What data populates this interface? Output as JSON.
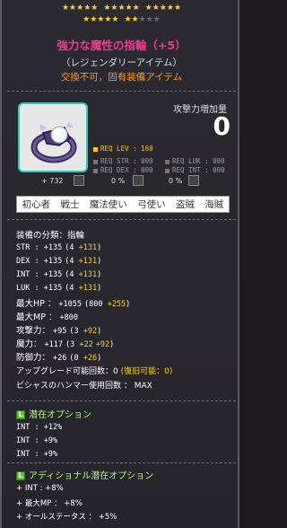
{
  "stars": {
    "row1_filled": 15,
    "row2_filled": 7,
    "row2_empty": 3
  },
  "item": {
    "name": "強力な魔性の指輪（+5）",
    "rarity": "（レジェンダリーアイテム）",
    "trade": "交換不可，固有装備アイテム"
  },
  "attack": {
    "label": "攻撃力増加量",
    "value": "0"
  },
  "requirements": {
    "lev": "REQ LEV : 160",
    "str": "REQ STR : 000",
    "dex": "REQ DEX : 000",
    "luk": "REQ LUK : 000",
    "int": "REQ INT : 000"
  },
  "mini_stats": [
    "+ 732",
    "0 %",
    "0 %"
  ],
  "jobs": [
    "初心者",
    "戦士",
    "魔法使い",
    "弓使い",
    "盗賊",
    "海賊"
  ],
  "stats": {
    "category": "装備の分類：指輪",
    "str": {
      "label": "STR : ",
      "total": "+135",
      "detail_open": "(4 ",
      "bonus": "+131",
      "detail_close": ")"
    },
    "dex": {
      "label": "DEX : ",
      "total": "+135",
      "detail_open": "(4 ",
      "bonus": "+131",
      "detail_close": ")"
    },
    "int": {
      "label": "INT : ",
      "total": "+135",
      "detail_open": "(4 ",
      "bonus": "+131",
      "detail_close": ")"
    },
    "luk": {
      "label": "LUK : ",
      "total": "+135",
      "detail_open": "(4 ",
      "bonus": "+131",
      "detail_close": ")"
    },
    "hp": {
      "label": "最大HP ： ",
      "total": "+1055",
      "detail_open": "(800 ",
      "bonus": "+255",
      "detail_close": ")"
    },
    "mp": {
      "label": "最大MP ： ",
      "total": "+800"
    },
    "atk": {
      "label": "攻撃力： ",
      "total": "+95",
      "detail_open": "(3 ",
      "bonus": "+92",
      "detail_close": ")"
    },
    "matk": {
      "label": "魔力： ",
      "total": "+117",
      "detail_open": "(3 ",
      "bonus_a": "+22",
      "bonus": "+92",
      "detail_close": ")"
    },
    "def": {
      "label": "防御力： ",
      "total": "+26",
      "detail_open": "(0 ",
      "bonus": "+26",
      "detail_close": ")"
    },
    "upgrade": {
      "text": "アップグレード可能回数：0 ",
      "recover": "(復旧可能：0)"
    },
    "hammer": "ビシャスのハンマー使用回数 ： MAX"
  },
  "potential": {
    "title": "潜在オプション",
    "lines": [
      "INT : +12%",
      "INT : +9%",
      "INT : +9%"
    ]
  },
  "additional": {
    "title": "アディショナル潜在オプション",
    "lines": [
      "+ INT : +8%",
      "+ 最大MP ： +8%",
      "+ オールステータス ： +5%"
    ]
  },
  "colors": {
    "title": "#ee3b8f",
    "trade": "#ff9a1a",
    "bonus": "#ffd21a",
    "potential": "#b5f57c",
    "icon_border": "#34c8b6"
  }
}
